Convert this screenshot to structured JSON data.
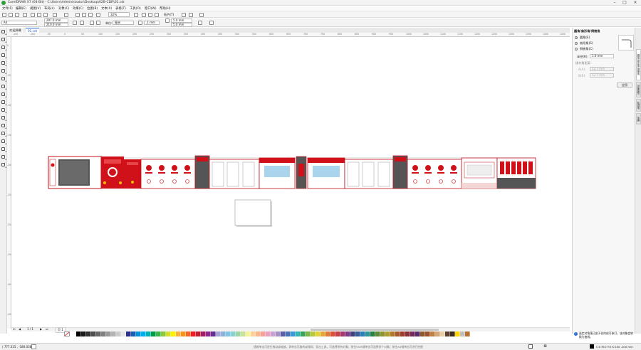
{
  "window": {
    "title": "CorelDRAW X7 (64-Bit) - C:\\Users\\Administrator\\Desktop\\02B-CDR\\01.cdr"
  },
  "menu": [
    "文件(F)",
    "编辑(E)",
    "视图(V)",
    "布局(L)",
    "对象(C)",
    "效果(C)",
    "位图(B)",
    "文本(X)",
    "表格(T)",
    "工具(O)",
    "窗口(W)",
    "帮助(H)"
  ],
  "toolbar": {
    "zoom": "32%",
    "snap_label": "贴齐(T)"
  },
  "propbar": {
    "page_size": "A4",
    "width": "297.0 mm",
    "height": "210.0 mm",
    "units_label": "单位:",
    "units": "毫米",
    "nudge": ".1 mm",
    "dup_x": "5.0 mm",
    "dup_y": "5.0 mm"
  },
  "tabs": [
    "欢迎屏幕",
    "01.cdr"
  ],
  "ruler_h": [
    "-150",
    "-100",
    "-50",
    "0",
    "50",
    "100",
    "150",
    "200",
    "250",
    "300",
    "350",
    "400",
    "450",
    "500",
    "550",
    "600",
    "650",
    "700",
    "750",
    "800",
    "850",
    "900",
    "950",
    "1000",
    "1050",
    "1100",
    "1150",
    "1200",
    "1250",
    "1300",
    "1350",
    "1400",
    "1450"
  ],
  "ruler_v": [
    "0",
    "-50",
    "-100",
    "-150",
    "-200",
    "-250",
    "-300",
    "-350",
    "-400",
    "-450"
  ],
  "docker": {
    "title": "圆角/扇形角/倒棱角",
    "options": [
      "圆角(E)",
      "扇形角(S)",
      "倒棱角(C)"
    ],
    "radius_label": "半径(R):",
    "radius_value": "1.0 mm",
    "cornerize_label": "操作角距离",
    "field_a_label": "A(A):",
    "field_a": "12.7 mm",
    "field_b_label": "B(B):",
    "field_b": "12.7 mm",
    "apply": "应用",
    "hint": "选定对角落已由于任何成可参打，该对象会转换为曲线。",
    "vtabs": [
      "圆角/扇形角/倒棱角",
      "对象属性",
      "轮廓笔",
      "变换"
    ]
  },
  "pagenav": {
    "current": "1 / 1",
    "page": "页 1"
  },
  "status": {
    "coords": "( 777.315 , -180.038 )",
    "center_hint": "接着单击可进行拖动或缩放，再单击可旋转或倾斜；双击工具，可选择所有对象；按住Shift键单击可选择多个对象；按住Alt键单击可进行挖掘",
    "fill_info": "C:0 M:0 Y:0 K:100 .200 mm"
  },
  "colors": {
    "accent_red": "#d0111a",
    "palette": [
      "#ffffff",
      "#000000",
      "#1a1a1a",
      "#333333",
      "#4d4d4d",
      "#666666",
      "#808080",
      "#999999",
      "#b3b3b3",
      "#cccccc",
      "#e6e6e6",
      "#2b2f8f",
      "#1c5fb0",
      "#0093dd",
      "#00aeef",
      "#00b3b0",
      "#009944",
      "#39b54a",
      "#8dc63f",
      "#d7df23",
      "#fff200",
      "#fbb040",
      "#f7941d",
      "#f26522",
      "#ed1c24",
      "#be1e2d",
      "#9e1f63",
      "#92278f",
      "#662d91",
      "#a3a3d6",
      "#8fb1d9",
      "#7ec5e6",
      "#89d2cd",
      "#9fd4a3",
      "#c8e29a",
      "#f4f29b",
      "#fcd29a",
      "#f9b58c",
      "#f5a09a",
      "#e7a0c2",
      "#c7a3cf",
      "#a592c6",
      "#5b5ea6",
      "#4873b7",
      "#3a9ad9",
      "#30b7b0",
      "#3aa35c",
      "#7ab648",
      "#b9c83a",
      "#e3d23a",
      "#e8a837",
      "#e07b35",
      "#d8503b",
      "#c83c4a",
      "#a33a6c",
      "#7e3a8a",
      "#40407a",
      "#355c9a",
      "#2f7fb7",
      "#2a9795",
      "#2c8046",
      "#5e8c35",
      "#8d9430",
      "#b09b2e",
      "#b07a2c",
      "#a65a2b",
      "#9c3d30",
      "#8c2f3d",
      "#702a55",
      "#5a2a6a",
      "#8b5a2b",
      "#a0522d",
      "#c08040",
      "#d2a679",
      "#e8cfa6",
      "#5c4033",
      "#3d2b1f",
      "#ffd700",
      "#c0c0c0",
      "#b87333"
    ]
  }
}
